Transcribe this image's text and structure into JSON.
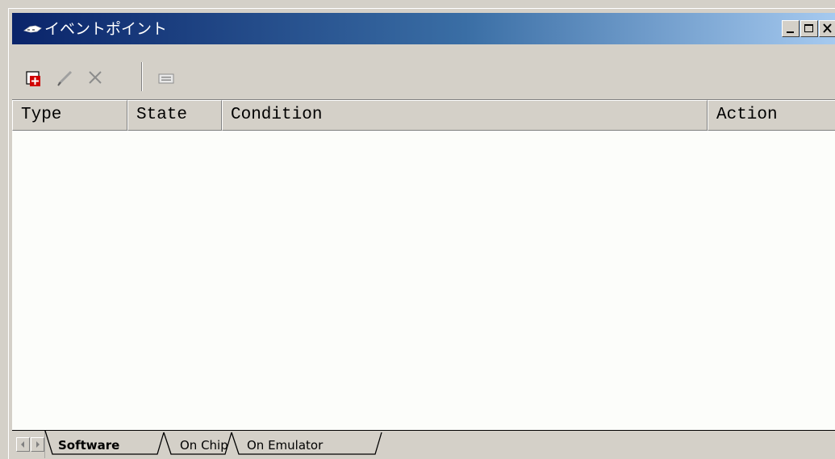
{
  "window": {
    "title": "イベントポイント"
  },
  "toolbar": {
    "buttons": [
      {
        "name": "add-icon"
      },
      {
        "name": "edit-icon"
      },
      {
        "name": "delete-icon"
      },
      {
        "name": "properties-icon"
      }
    ]
  },
  "list": {
    "columns": [
      "Type",
      "State",
      "Condition",
      "Action"
    ],
    "rows": []
  },
  "tabs": {
    "items": [
      "Software",
      "On Chip",
      "On Emulator"
    ],
    "selected": "Software"
  }
}
